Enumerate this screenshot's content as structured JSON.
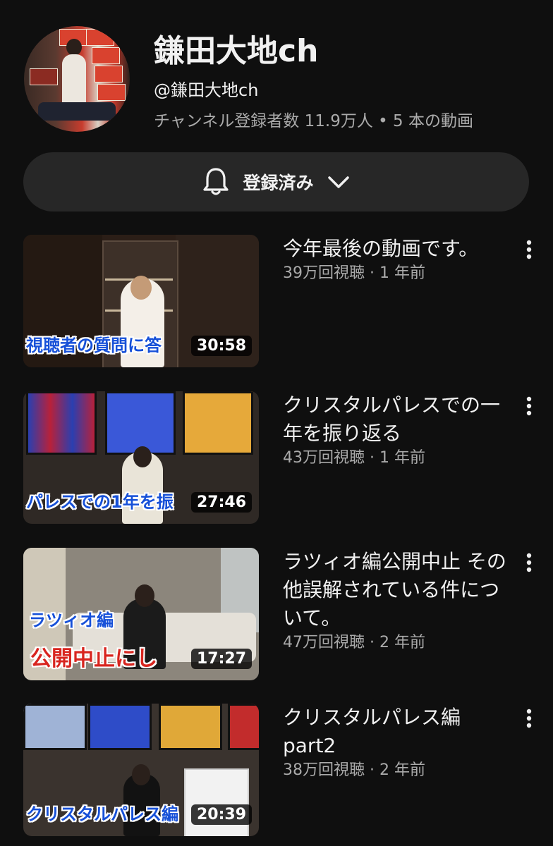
{
  "channel": {
    "title": "鎌田大地ch",
    "handle": "@鎌田大地ch",
    "stats": "チャンネル登録者数 11.9万人 • 5 本の動画",
    "avatar_icon": "channel-avatar"
  },
  "subscribe": {
    "label": "登録済み",
    "bell_icon": "bell-icon",
    "chevron_icon": "chevron-down-icon"
  },
  "videos": [
    {
      "title": "今年最後の動画です。",
      "meta": "39万回視聴 · 1 年前",
      "duration": "30:58",
      "thumb_caption": "視聴者の質問に答"
    },
    {
      "title": "クリスタルパレスでの一年を振り返る",
      "meta": "43万回視聴 · 1 年前",
      "duration": "27:46",
      "thumb_caption": "パレスでの1年を振"
    },
    {
      "title": "ラツィオ編公開中止 その他誤解されている件について。",
      "meta": "47万回視聴 · 2 年前",
      "duration": "17:27",
      "thumb_caption": "ラツィオ編",
      "thumb_caption2": "公開中止にし"
    },
    {
      "title": "クリスタルパレス編 part2",
      "meta": "38万回視聴 · 2 年前",
      "duration": "20:39",
      "thumb_caption": "クリスタルパレス編"
    }
  ],
  "colors": {
    "background": "#0f0f0f",
    "button_bg": "#272727",
    "secondary_text": "#aaaaaa",
    "caption_blue": "#1650d8",
    "caption_red": "#d8251f"
  }
}
